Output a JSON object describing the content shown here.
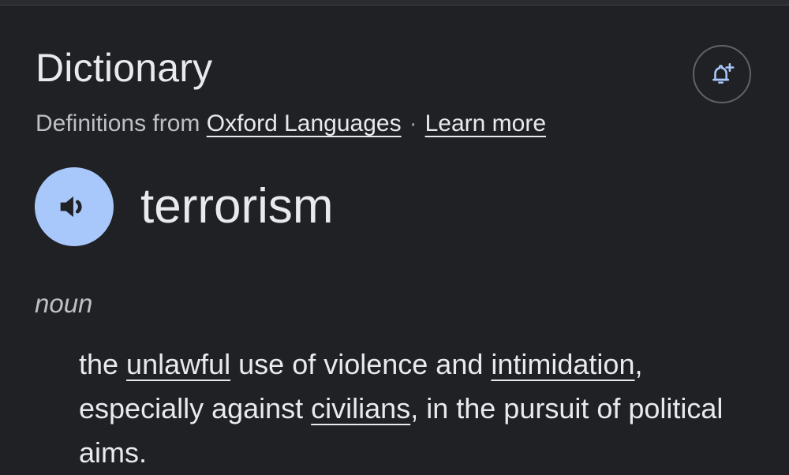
{
  "header": {
    "title": "Dictionary",
    "alert_icon": "add-alert-icon"
  },
  "source": {
    "prefix": "Definitions from",
    "provider": "Oxford Languages",
    "separator": "·",
    "learn_more": "Learn more"
  },
  "entry": {
    "pronounce_icon": "speaker-icon",
    "word": "terrorism",
    "part_of_speech": "noun",
    "definition": {
      "t1": "the ",
      "link1": "unlawful",
      "t2": " use of violence and ",
      "link2": "intimidation",
      "t3": ", especially against ",
      "link3": "civilians",
      "t4": ", in the pursuit of political aims."
    }
  },
  "colors": {
    "background": "#202124",
    "text": "#e8eaed",
    "muted_text": "#bdc1c6",
    "accent": "#a8c7fa"
  }
}
